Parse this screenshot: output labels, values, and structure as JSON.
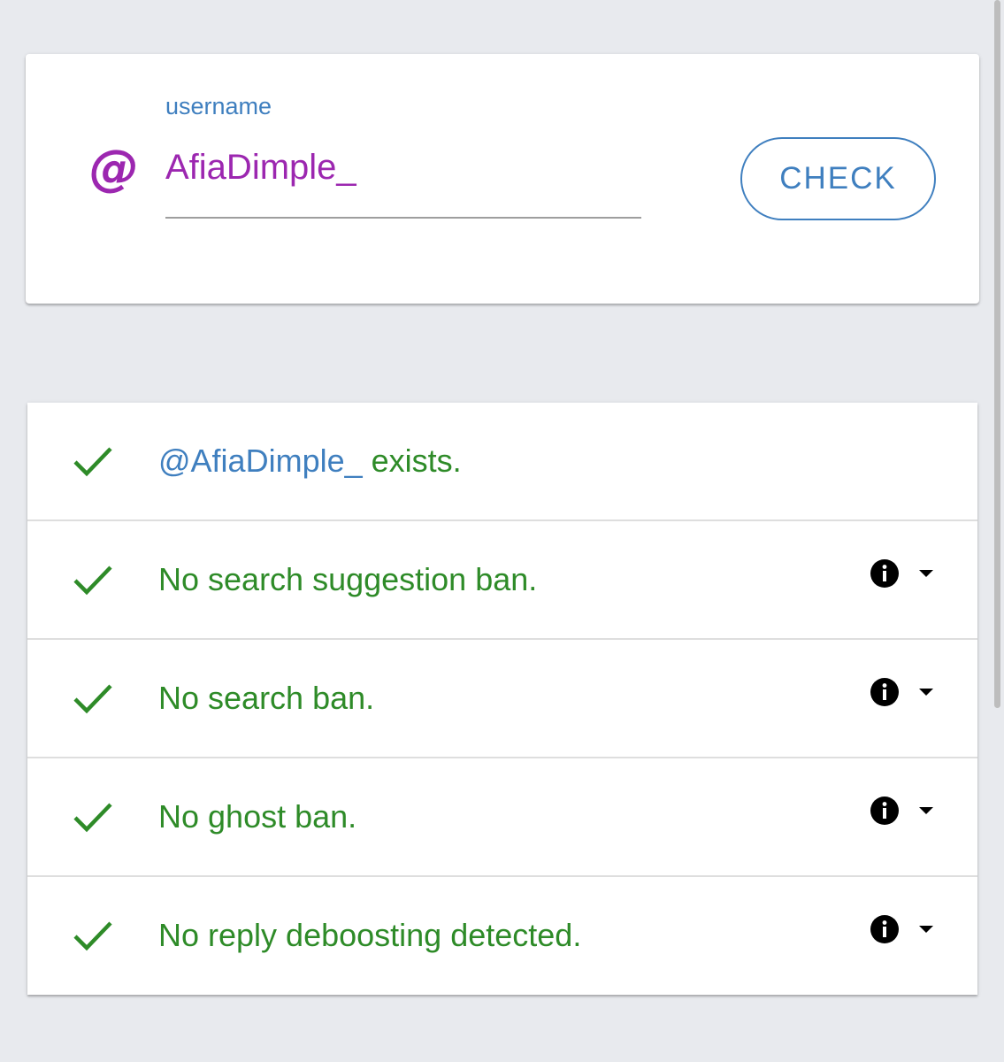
{
  "search": {
    "label": "username",
    "at_symbol": "@",
    "username_value": "AfiaDimple_",
    "check_button_label": "CHECK"
  },
  "results": [
    {
      "id": "exists",
      "status": "ok",
      "handle": "@AfiaDimple_",
      "text": " exists.",
      "has_info": false
    },
    {
      "id": "search-suggestion-ban",
      "status": "ok",
      "text": "No search suggestion ban.",
      "has_info": true
    },
    {
      "id": "search-ban",
      "status": "ok",
      "text": "No search ban.",
      "has_info": true
    },
    {
      "id": "ghost-ban",
      "status": "ok",
      "text": "No ghost ban.",
      "has_info": true
    },
    {
      "id": "reply-deboosting",
      "status": "ok",
      "text": "No reply deboosting detected.",
      "has_info": true
    }
  ],
  "colors": {
    "accent_blue": "#3f7fbf",
    "accent_purple": "#9c27b0",
    "success_green": "#2e8b28",
    "background": "#e8eaee"
  },
  "icons": {
    "at": "at-icon",
    "check": "checkmark-icon",
    "info": "info-icon",
    "dropdown": "caret-down-icon"
  }
}
